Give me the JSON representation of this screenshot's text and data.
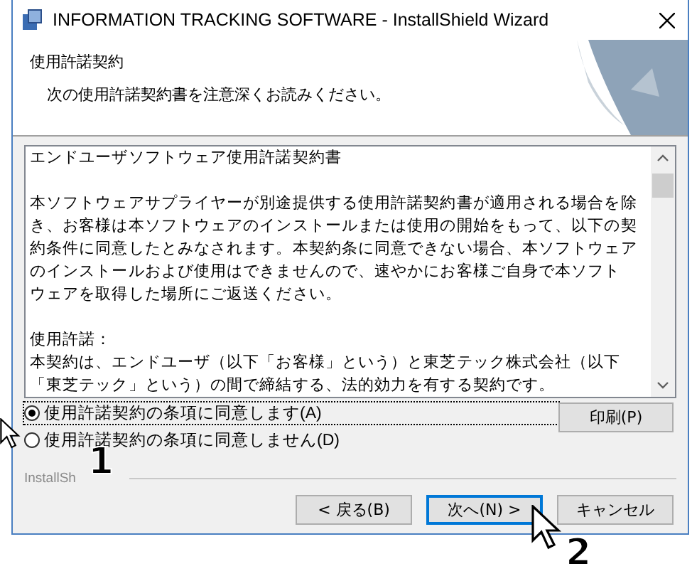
{
  "window": {
    "title": "INFORMATION TRACKING SOFTWARE - InstallShield Wizard"
  },
  "header": {
    "title": "使用許諾契約",
    "subtitle": "次の使用許諾契約書を注意深くお読みください。"
  },
  "license_text": [
    [
      "エンドユーザソフトウェア使用許諾契約書"
    ],
    [
      "本ソフトウェアサプライヤーが別途提供する使用許諾契約書が適用される場合を除",
      "き、お客様は本ソフトウェアのインストールまたは使用の開始をもって、以下の契",
      "約条件に同意したとみなされます。本契約条に同意できない場合、本ソフトウェア",
      "のインストールおよび使用はできませんので、速やかにお客様ご自身で本ソフト",
      "ウェアを取得した場所にご返送ください。"
    ],
    [
      "使用許諾：",
      "本契約は、エンドユーザ（以下「お客様」という）と東芝テック株式会社（以下",
      "「東芝テック」という）の間で締結する、法的効力を有する契約です。"
    ]
  ],
  "options": [
    {
      "label": "使用許諾契約の条項に同意します(A)",
      "selected": true
    },
    {
      "label": "使用許諾契約の条項に同意しません(D)",
      "selected": false
    }
  ],
  "print_button": "印刷(P)",
  "brand": "InstallSh",
  "buttons": [
    {
      "label": "< 戻る(B)",
      "default": false
    },
    {
      "label": "次へ(N) >",
      "default": true
    },
    {
      "label": "キャンセル",
      "default": false
    }
  ],
  "callouts": [
    "1",
    "2"
  ]
}
